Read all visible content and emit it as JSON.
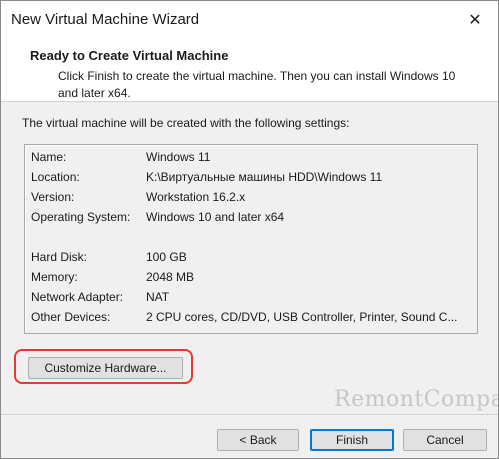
{
  "window": {
    "title": "New Virtual Machine Wizard",
    "close_glyph": "✕"
  },
  "header": {
    "title": "Ready to Create Virtual Machine",
    "description": "Click Finish to create the virtual machine. Then you can install Windows 10 and later x64."
  },
  "main": {
    "intro": "The virtual machine will be created with the following settings:",
    "settings": [
      {
        "label": "Name:",
        "value": "Windows 11"
      },
      {
        "label": "Location:",
        "value": "K:\\Виртуальные машины HDD\\Windows 11"
      },
      {
        "label": "Version:",
        "value": "Workstation 16.2.x"
      },
      {
        "label": "Operating System:",
        "value": "Windows 10 and later x64"
      },
      {
        "label": "Hard Disk:",
        "value": "100 GB"
      },
      {
        "label": "Memory:",
        "value": "2048 MB"
      },
      {
        "label": "Network Adapter:",
        "value": "NAT"
      },
      {
        "label": "Other Devices:",
        "value": "2 CPU cores, CD/DVD, USB Controller, Printer, Sound C..."
      }
    ],
    "customize_label": "Customize Hardware..."
  },
  "footer": {
    "back_label": "< Back",
    "finish_label": "Finish",
    "cancel_label": "Cancel"
  },
  "watermark": "RemontCompa.ru",
  "colors": {
    "highlight": "#e53935",
    "accent": "#0078d7"
  }
}
